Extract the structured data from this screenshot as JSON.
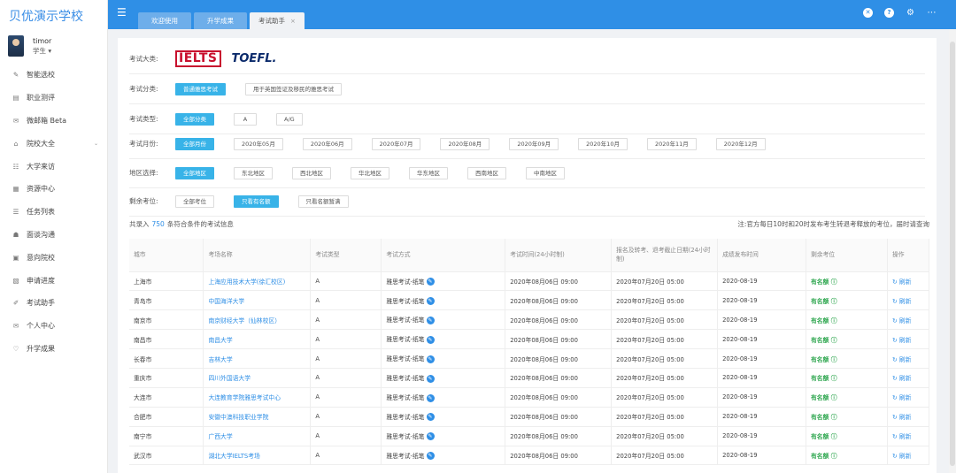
{
  "app": {
    "logo": "贝优演示学校"
  },
  "user": {
    "name": "timor",
    "role": "学生 ▾"
  },
  "sidebar": {
    "items": [
      {
        "label": "智能选校",
        "icon": "✎"
      },
      {
        "label": "职业测评",
        "icon": "▤"
      },
      {
        "label": "微邮箱 Beta",
        "icon": "✉"
      },
      {
        "label": "院校大全",
        "icon": "⌂",
        "arrow": "⌄"
      },
      {
        "label": "大学来访",
        "icon": "☷"
      },
      {
        "label": "资源中心",
        "icon": "▦"
      },
      {
        "label": "任务列表",
        "icon": "☰"
      },
      {
        "label": "面谈沟通",
        "icon": "☗"
      },
      {
        "label": "意向院校",
        "icon": "▣"
      },
      {
        "label": "申请进度",
        "icon": "▧"
      },
      {
        "label": "考试助手",
        "icon": "✐"
      },
      {
        "label": "个人中心",
        "icon": "✉"
      },
      {
        "label": "升学成果",
        "icon": "♡"
      }
    ]
  },
  "topbar": {
    "tabs": [
      {
        "label": "欢迎使用"
      },
      {
        "label": "升学成果"
      },
      {
        "label": "考试助手",
        "close": "×"
      }
    ]
  },
  "filters": {
    "exam_label": "考试大类:",
    "ielts": "IELTS",
    "toefl": "TOEFL.",
    "category_label": "考试分类:",
    "categories": [
      "普通雅思考试",
      "用于英国签证及移民的雅思考试"
    ],
    "type_label": "考试类型:",
    "types": [
      "全部分类",
      "A",
      "A/G"
    ],
    "month_label": "考试月份:",
    "months": [
      "全部月份",
      "2020年05月",
      "2020年06月",
      "2020年07月",
      "2020年08月",
      "2020年09月",
      "2020年10月",
      "2020年11月",
      "2020年12月"
    ],
    "region_label": "地区选择:",
    "regions": [
      "全部地区",
      "东北地区",
      "西北地区",
      "华北地区",
      "华东地区",
      "西南地区",
      "中南地区"
    ],
    "seat_label": "剩余考位:",
    "seats": [
      "全部考位",
      "只看有名额",
      "只看名额暂满"
    ]
  },
  "summary": {
    "prefix": "共录入",
    "count": "750",
    "suffix": "条符合条件的考试信息",
    "note": "注:官方每日10时和20时发布考生转退考释放的考位，届时请查询"
  },
  "table": {
    "headers": [
      "城市",
      "考场名称",
      "考试类型",
      "考试方式",
      "考试时间(24小时制)",
      "报名及转考、退考截止日期(24小时制)",
      "成绩发布时间",
      "剩余考位",
      "操作"
    ],
    "rows": [
      [
        "上海市",
        "上海应用技术大学(徐汇校区)",
        "A",
        "雅思考试-纸笔",
        "2020年08月06日 09:00",
        "2020年07月20日 05:00",
        "2020-08-19",
        "有名额 ⓘ",
        "↻ 刷新"
      ],
      [
        "青岛市",
        "中国海洋大学",
        "A",
        "雅思考试-纸笔",
        "2020年08月06日 09:00",
        "2020年07月20日 05:00",
        "2020-08-19",
        "有名额 ⓘ",
        "↻ 刷新"
      ],
      [
        "南京市",
        "南京财经大学（仙林校区）",
        "A",
        "雅思考试-纸笔",
        "2020年08月06日 09:00",
        "2020年07月20日 05:00",
        "2020-08-19",
        "有名额 ⓘ",
        "↻ 刷新"
      ],
      [
        "南昌市",
        "南昌大学",
        "A",
        "雅思考试-纸笔",
        "2020年08月06日 09:00",
        "2020年07月20日 05:00",
        "2020-08-19",
        "有名额 ⓘ",
        "↻ 刷新"
      ],
      [
        "长春市",
        "吉林大学",
        "A",
        "雅思考试-纸笔",
        "2020年08月06日 09:00",
        "2020年07月20日 05:00",
        "2020-08-19",
        "有名额 ⓘ",
        "↻ 刷新"
      ],
      [
        "重庆市",
        "四川外国语大学",
        "A",
        "雅思考试-纸笔",
        "2020年08月06日 09:00",
        "2020年07月20日 05:00",
        "2020-08-19",
        "有名额 ⓘ",
        "↻ 刷新"
      ],
      [
        "大连市",
        "大连教育学院雅思考试中心",
        "A",
        "雅思考试-纸笔",
        "2020年08月06日 09:00",
        "2020年07月20日 05:00",
        "2020-08-19",
        "有名额 ⓘ",
        "↻ 刷新"
      ],
      [
        "合肥市",
        "安徽中澳科技职业学院",
        "A",
        "雅思考试-纸笔",
        "2020年08月06日 09:00",
        "2020年07月20日 05:00",
        "2020-08-19",
        "有名额 ⓘ",
        "↻ 刷新"
      ],
      [
        "南宁市",
        "广西大学",
        "A",
        "雅思考试-纸笔",
        "2020年08月06日 09:00",
        "2020年07月20日 05:00",
        "2020-08-19",
        "有名额 ⓘ",
        "↻ 刷新"
      ],
      [
        "武汉市",
        "湖北大学IELTS考场",
        "A",
        "雅思考试-纸笔",
        "2020年08月06日 09:00",
        "2020年07月20日 05:00",
        "2020-08-19",
        "有名额 ⓘ",
        "↻ 刷新"
      ]
    ]
  },
  "colors": {
    "accent": "#2f8fe6",
    "selected": "#38b3e8",
    "green": "#32a852"
  }
}
